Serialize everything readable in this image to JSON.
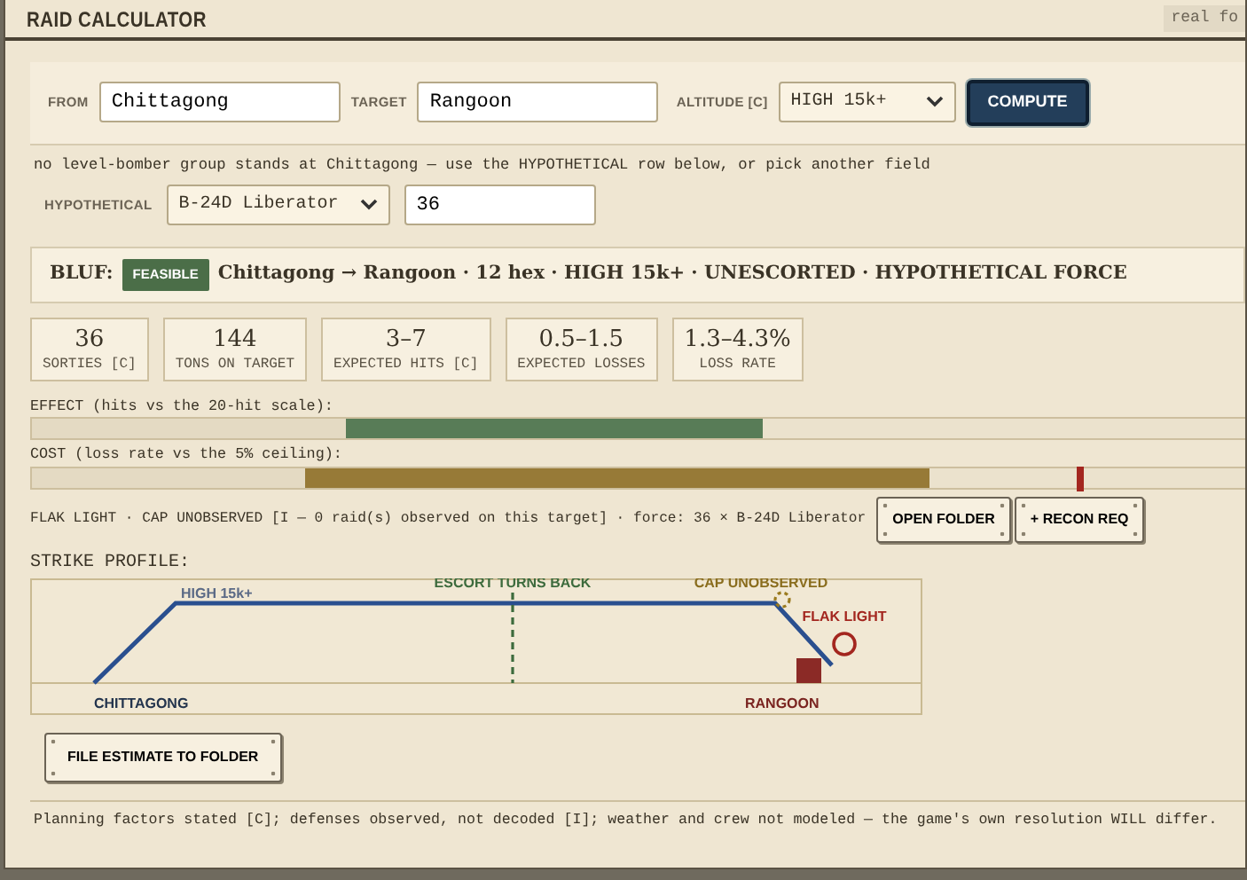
{
  "header": {
    "title": "RAID CALCULATOR",
    "badge": "real fo"
  },
  "form": {
    "from": {
      "label": "FROM",
      "value": "Chittagong"
    },
    "target": {
      "label": "TARGET",
      "value": "Rangoon"
    },
    "altitude": {
      "label": "ALTITUDE [C]",
      "value": "HIGH 15k+"
    },
    "compute": "COMPUTE"
  },
  "note": "no level-bomber group stands at Chittagong — use the HYPOTHETICAL row below, or pick another field",
  "hypothetical": {
    "label": "HYPOTHETICAL",
    "aircraft": "B-24D Liberator",
    "count": "36"
  },
  "bluf": {
    "label": "BLUF:",
    "status": "FEASIBLE",
    "summary": "Chittagong → Rangoon · 12 hex · HIGH 15k+ · UNESCORTED · HYPOTHETICAL FORCE"
  },
  "metrics": [
    {
      "value": "36",
      "label": "SORTIES [C]"
    },
    {
      "value": "144",
      "label": "TONS ON TARGET"
    },
    {
      "value": "3–7",
      "label": "EXPECTED HITS [C]"
    },
    {
      "value": "0.5–1.5",
      "label": "EXPECTED LOSSES"
    },
    {
      "value": "1.3–4.3%",
      "label": "LOSS RATE"
    }
  ],
  "bars": [
    {
      "label": "EFFECT (hits vs the 20-hit scale):",
      "kind": "effect",
      "level": 0.6,
      "floor": {
        "level": 0.257
      }
    },
    {
      "label": "COST (loss rate vs the 5% ceiling):",
      "kind": "cost",
      "level": 0.736,
      "floor": {
        "level": 0.224
      },
      "ceiling": {
        "level": 0.857
      }
    }
  ],
  "intel": "FLAK LIGHT · CAP UNOBSERVED [I — 0 raid(s) observed on this target] · force: 36 × B-24D Liberator",
  "intel_buttons": [
    "OPEN FOLDER",
    "+ RECON REQ"
  ],
  "strike_profile": {
    "label": "STRIKE PROFILE:",
    "altitude": "HIGH 15k+",
    "escort": "ESCORT TURNS BACK",
    "cap": "CAP UNOBSERVED",
    "flak": "FLAK LIGHT",
    "origin": "CHITTAGONG",
    "destination": "RANGOON"
  },
  "file_button": "FILE ESTIMATE TO FOLDER",
  "footer": "Planning factors stated [C]; defenses observed, not decoded [I]; weather and crew not modeled — the game's own resolution WILL differ."
}
